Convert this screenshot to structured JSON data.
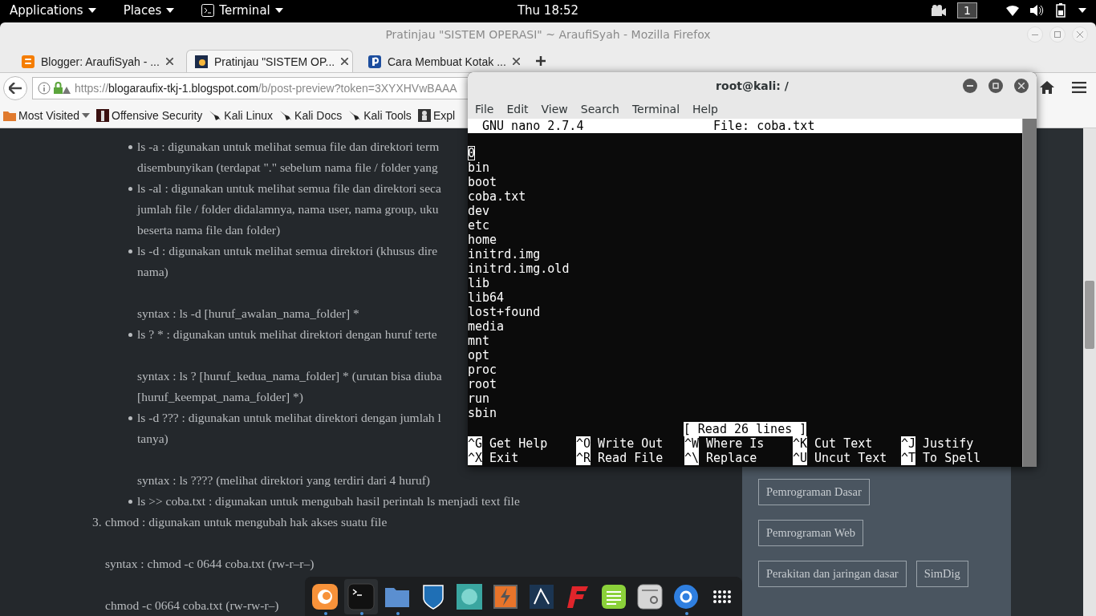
{
  "top_bar": {
    "menus": [
      {
        "label": "Applications"
      },
      {
        "label": "Places"
      },
      {
        "label": "Terminal"
      }
    ],
    "clock": "Thu 18:52",
    "workspace": "1"
  },
  "firefox": {
    "title": "Pratinjau \"SISTEM OPERASI\" ~ AraufiSyah - Mozilla Firefox",
    "tabs": [
      {
        "label": "Blogger: AraufiSyah - ...",
        "selected": false
      },
      {
        "label": "Pratinjau \"SISTEM OP...",
        "selected": true
      },
      {
        "label": "Cara Membuat Kotak ...",
        "selected": false
      }
    ],
    "url": {
      "scheme": "https://",
      "host": "blogaraufix-tkj-1.blogspot.com",
      "path": "/b/post-preview?token=3XYXHVwBAAA"
    },
    "bookmarks": [
      {
        "label": "Most Visited",
        "kind": "folder"
      },
      {
        "label": "Offensive Security",
        "kind": "offsec"
      },
      {
        "label": "Kali Linux",
        "kind": "kali"
      },
      {
        "label": "Kali Docs",
        "kind": "kali"
      },
      {
        "label": "Kali Tools",
        "kind": "kali"
      },
      {
        "label": "Expl",
        "kind": "exploit"
      }
    ]
  },
  "article": {
    "lines": [
      {
        "kind": "bullet",
        "text": "ls -a : digunakan untuk melihat semua file dan direktori term",
        "space_before": false
      },
      {
        "kind": "cont",
        "text": "disembunyikan (terdapat \".\" sebelum nama file / folder yang",
        "space_before": false
      },
      {
        "kind": "bullet",
        "text": "ls -al : digunakan untuk melihat semua file dan direktori seca",
        "space_before": false
      },
      {
        "kind": "cont",
        "text": "jumlah file / folder didalamnya, nama user, nama group, uku",
        "space_before": false
      },
      {
        "kind": "cont",
        "text": "beserta nama file dan folder)",
        "space_before": false
      },
      {
        "kind": "bullet",
        "text": "ls -d : digunakan untuk melihat semua direktori (khusus dire",
        "space_before": false
      },
      {
        "kind": "cont",
        "text": "nama)",
        "space_before": false
      },
      {
        "kind": "cont",
        "text": "syntax : ls -d [huruf_awalan_nama_folder] *",
        "space_before": true
      },
      {
        "kind": "bullet",
        "text": "ls ? * : digunakan untuk melihat direktori dengan huruf terte",
        "space_before": false
      },
      {
        "kind": "cont",
        "text": "syntax : ls ? [huruf_kedua_nama_folder] * (urutan bisa diuba",
        "space_before": true
      },
      {
        "kind": "cont",
        "text": "[huruf_keempat_nama_folder] *)",
        "space_before": false
      },
      {
        "kind": "bullet",
        "text": "ls -d ??? : digunakan untuk melihat direktori dengan jumlah l",
        "space_before": false
      },
      {
        "kind": "cont",
        "text": "tanya)",
        "space_before": false
      },
      {
        "kind": "cont",
        "text": "syntax : ls ???? (melihat direktori yang terdiri dari 4 huruf)",
        "space_before": true
      },
      {
        "kind": "bullet",
        "text": "ls >> coba.txt : digunakan untuk mengubah hasil perintah ls menjadi text file",
        "space_before": false
      },
      {
        "kind": "numbered",
        "number": "3.",
        "text": "chmod : digunakan untuk mengubah hak akses suatu file",
        "space_before": false
      },
      {
        "kind": "body",
        "text": "syntax : chmod -c 0644 coba.txt (rw-r–r–)",
        "space_before": true
      },
      {
        "kind": "body",
        "text": "chmod -c 0664 coba.txt (rw-rw-r–)",
        "space_before": true
      }
    ]
  },
  "sidebar": {
    "tags": [
      {
        "label": "Pemrograman Dasar"
      },
      {
        "label": "Pemrograman Web"
      },
      {
        "label": "Perakitan dan jaringan dasar"
      },
      {
        "label": "SimDig"
      }
    ]
  },
  "terminal": {
    "title": "root@kali: /",
    "menus": [
      "File",
      "Edit",
      "View",
      "Search",
      "Terminal",
      "Help"
    ],
    "nano": {
      "version": "GNU nano 2.7.4",
      "file": "File: coba.txt",
      "lines": [
        {
          "text": "0",
          "cursor": true
        },
        {
          "text": "bin",
          "cursor": false
        },
        {
          "text": "boot",
          "cursor": false
        },
        {
          "text": "coba.txt",
          "cursor": false
        },
        {
          "text": "dev",
          "cursor": false
        },
        {
          "text": "etc",
          "cursor": false
        },
        {
          "text": "home",
          "cursor": false
        },
        {
          "text": "initrd.img",
          "cursor": false
        },
        {
          "text": "initrd.img.old",
          "cursor": false
        },
        {
          "text": "lib",
          "cursor": false
        },
        {
          "text": "lib64",
          "cursor": false
        },
        {
          "text": "lost+found",
          "cursor": false
        },
        {
          "text": "media",
          "cursor": false
        },
        {
          "text": "mnt",
          "cursor": false
        },
        {
          "text": "opt",
          "cursor": false
        },
        {
          "text": "proc",
          "cursor": false
        },
        {
          "text": "root",
          "cursor": false
        },
        {
          "text": "run",
          "cursor": false
        },
        {
          "text": "sbin",
          "cursor": false
        }
      ],
      "status": "[ Read 26 lines ]",
      "shortcuts": [
        {
          "key": "^G",
          "label": "Get Help"
        },
        {
          "key": "^O",
          "label": "Write Out"
        },
        {
          "key": "^W",
          "label": "Where Is"
        },
        {
          "key": "^K",
          "label": "Cut Text"
        },
        {
          "key": "^J",
          "label": "Justify"
        },
        {
          "key": "^X",
          "label": "Exit"
        },
        {
          "key": "^R",
          "label": "Read File"
        },
        {
          "key": "^\\",
          "label": "Replace"
        },
        {
          "key": "^U",
          "label": "Uncut Text"
        },
        {
          "key": "^T",
          "label": "To Spell"
        }
      ]
    }
  },
  "dock": [
    {
      "kind": "firefox",
      "running": true
    },
    {
      "kind": "terminal",
      "running": true
    },
    {
      "kind": "files",
      "running": true
    },
    {
      "kind": "shield",
      "running": false
    },
    {
      "kind": "avatar",
      "running": false
    },
    {
      "kind": "burp",
      "running": false
    },
    {
      "kind": "armitage",
      "running": false
    },
    {
      "kind": "faraday",
      "running": false
    },
    {
      "kind": "notes",
      "running": false
    },
    {
      "kind": "settings",
      "running": false
    },
    {
      "kind": "blue",
      "running": true
    },
    {
      "kind": "grid",
      "running": false
    }
  ]
}
